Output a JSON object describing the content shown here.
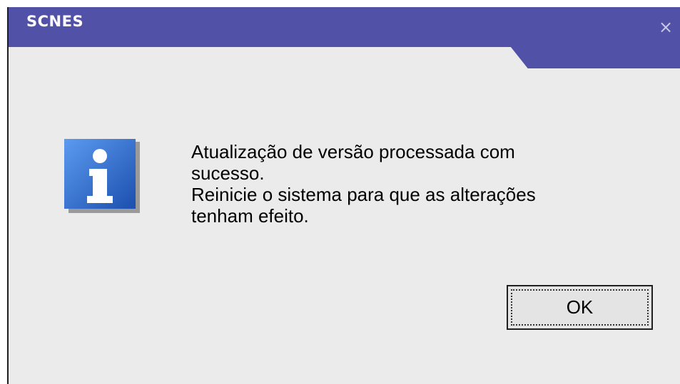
{
  "window": {
    "title": "SCNES",
    "close_glyph": "×"
  },
  "icon": {
    "name": "info-icon",
    "glyph": "i",
    "color": "#2f6fd8"
  },
  "message": {
    "lines": [
      "Atualização de versão processada com",
      "sucesso.",
      "Reinicie o sistema para que as alterações",
      "tenham efeito."
    ]
  },
  "buttons": {
    "ok_label": "OK"
  },
  "colors": {
    "titlebar": "#5151a8",
    "dialog_background": "#ebebeb"
  }
}
